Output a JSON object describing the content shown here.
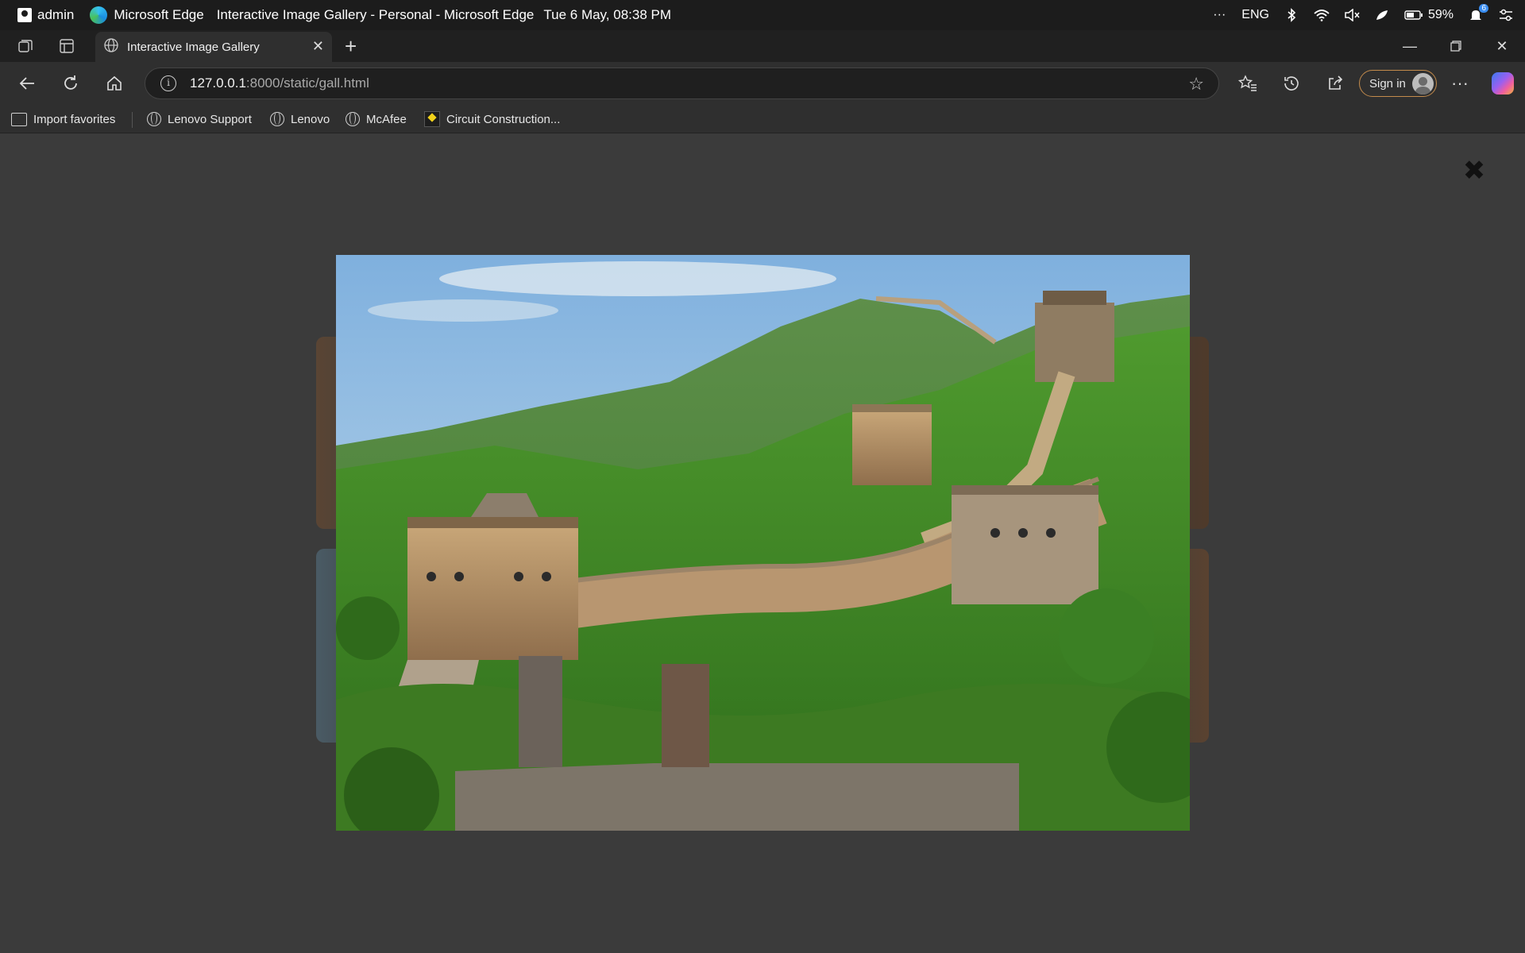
{
  "os": {
    "user": "admin",
    "app_name": "Microsoft Edge",
    "window_title": "Interactive Image Gallery - Personal - Microsoft Edge",
    "datetime": "Tue 6 May, 08:38 PM",
    "language": "ENG",
    "battery": "59%",
    "notifications_count": "6"
  },
  "tabs": [
    {
      "label": "Interactive Image Gallery"
    }
  ],
  "address": {
    "host": "127.0.0.1",
    "rest": ":8000/static/gall.html"
  },
  "signin_label": "Sign in",
  "favorites": [
    {
      "label": "Import favorites",
      "icon": "import-icon"
    },
    {
      "label": "Lenovo Support",
      "icon": "globe-icon"
    },
    {
      "label": "Lenovo",
      "icon": "globe-icon"
    },
    {
      "label": "McAfee",
      "icon": "globe-icon"
    },
    {
      "label": "Circuit Construction...",
      "icon": "phet-icon"
    }
  ],
  "lightbox": {
    "close_symbol": "✖",
    "image_subject": "Great Wall of China landscape"
  },
  "colors": {
    "page_background": "#3b3b3b",
    "chrome_dark": "#202020",
    "toolbar": "#2f2f2f",
    "signin_border": "#c38b4c"
  }
}
